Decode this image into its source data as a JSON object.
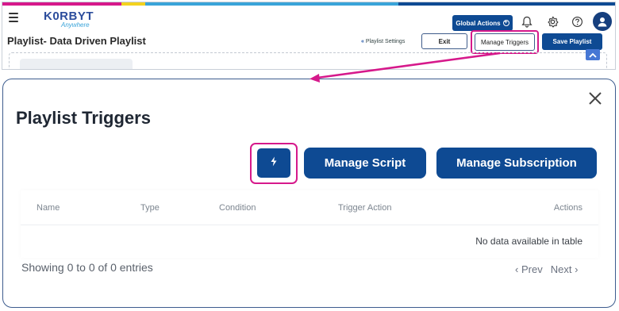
{
  "header": {
    "stripe_colors": [
      "#d6198b",
      "#f3d21f",
      "#3aa4d9",
      "#0e4a93"
    ],
    "logo_text": "K0RBYT",
    "logo_subtext": "Anywhere",
    "global_actions_label": "Global Actions",
    "page_title": "Playlist- Data Driven Playlist",
    "playlist_settings_label": "Playlist Settings",
    "exit_label": "Exit",
    "manage_triggers_label": "Manage Triggers",
    "save_playlist_label": "Save Playlist"
  },
  "modal": {
    "title": "Playlist Triggers",
    "manage_script_label": "Manage Script",
    "manage_subscription_label": "Manage Subscription",
    "table": {
      "columns": [
        "Name",
        "Type",
        "Condition",
        "Trigger Action",
        "Actions"
      ],
      "rows": [],
      "empty_message": "No data available in table"
    },
    "info": "Showing 0 to 0 of 0 entries",
    "prev_label": "Prev",
    "next_label": "Next"
  },
  "colors": {
    "primary": "#0e4a93",
    "highlight": "#d6198b",
    "accent": "#3aa4d9"
  }
}
